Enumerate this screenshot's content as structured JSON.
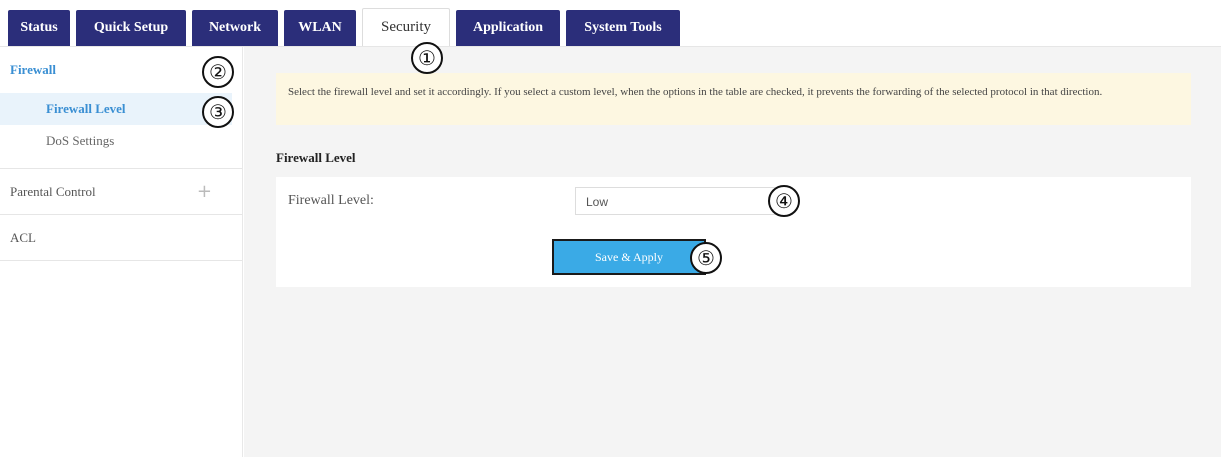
{
  "nav": {
    "tabs": [
      {
        "label": "Status"
      },
      {
        "label": "Quick Setup"
      },
      {
        "label": "Network"
      },
      {
        "label": "WLAN"
      },
      {
        "label": "Security"
      },
      {
        "label": "Application"
      },
      {
        "label": "System Tools"
      }
    ],
    "active": "Security"
  },
  "sidebar": {
    "firewall": {
      "label": "Firewall",
      "items": [
        "Firewall Level",
        "DoS Settings"
      ]
    },
    "parental_control": {
      "label": "Parental Control",
      "expand_icon": "+"
    },
    "acl": {
      "label": "ACL"
    }
  },
  "main": {
    "note": "Select the firewall level and set it accordingly. If you select a custom level, when the options in the table are checked, it prevents the forwarding of the selected protocol in that direction.",
    "section_title": "Firewall Level",
    "field_label": "Firewall Level:",
    "field_value": "Low",
    "save_label": "Save & Apply"
  },
  "callouts": [
    "①",
    "②",
    "③",
    "④",
    "⑤"
  ],
  "colors": {
    "nav_bg": "#2b2e7a",
    "accent": "#3a8fd3",
    "button": "#3aaae6",
    "note_bg": "#fdf7e1"
  }
}
